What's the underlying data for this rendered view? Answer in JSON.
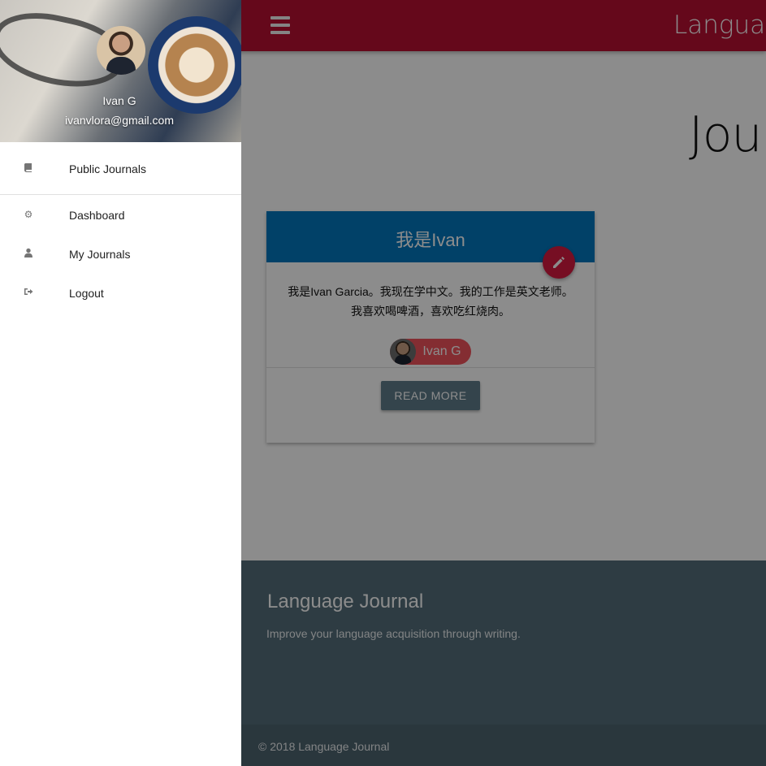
{
  "header": {
    "brand": "Languag"
  },
  "page": {
    "title": "Jou"
  },
  "card": {
    "title": "我是Ivan",
    "body": "我是Ivan Garcia。我现在学中文。我的工作是英文老师。我喜欢喝啤酒，喜欢吃红烧肉。",
    "author_chip": "Ivan G",
    "read_more_label": "READ MORE"
  },
  "footer": {
    "title": "Language Journal",
    "tagline": "Improve your language acquisition through writing.",
    "copyright": "© 2018 Language Journal"
  },
  "sidenav": {
    "user": {
      "name": "Ivan G",
      "email": "ivanvlora@gmail.com"
    },
    "items": [
      {
        "label": "Public Journals",
        "icon": "book-icon"
      },
      {
        "label": "Dashboard",
        "icon": "gear-icon"
      },
      {
        "label": "My Journals",
        "icon": "user-icon"
      },
      {
        "label": "Logout",
        "icon": "sign-out-icon"
      }
    ]
  },
  "colors": {
    "navbar": "#b80f32",
    "card_header": "#0277bd",
    "fab": "#d81b40",
    "chip": "#f0525c",
    "button": "#607d8b",
    "footer": "#546e7a"
  }
}
